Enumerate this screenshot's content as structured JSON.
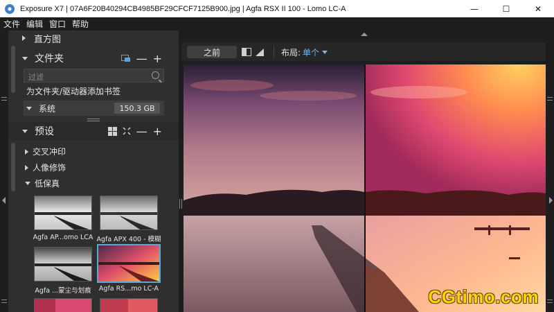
{
  "window": {
    "title": "Exposure X7 | 07A6F20B40294CB4985BF29CFCF7125B900.jpg | Agfa RSX II 100 - Lomo LC-A",
    "minimize": "—",
    "maximize": "☐",
    "close": "✕"
  },
  "menu": [
    "文件",
    "编辑",
    "窗口",
    "帮助"
  ],
  "panels": {
    "histogram": {
      "label": "直方图"
    },
    "folders": {
      "label": "文件夹",
      "minus": "—",
      "plus": "+",
      "filter_placeholder": "过滤",
      "bookmark_hint": "为文件夹/驱动器添加书签",
      "drive": {
        "name": "系统",
        "size": "150.3 GB"
      }
    },
    "presets": {
      "label": "预设",
      "minus": "—",
      "plus": "+",
      "groups": [
        "交叉冲印",
        "人像修饰",
        "低保真"
      ],
      "thumbnails": [
        {
          "caption": "Agfa AP...omo LCA"
        },
        {
          "caption": "Agfa APX 400 - 模糊"
        },
        {
          "caption": "Agfa ...蒙尘与划痕"
        },
        {
          "caption": "Agfa RS...mo LC-A",
          "selected": true
        }
      ]
    }
  },
  "toolbar": {
    "before_label": "之前",
    "layout_label": "布局:",
    "layout_value": "单个"
  },
  "watermark": "CGtimo.com",
  "colors": {
    "accent": "#5aa8d8",
    "layout_value": "#7fb3e0",
    "watermark": "#ffd400"
  }
}
